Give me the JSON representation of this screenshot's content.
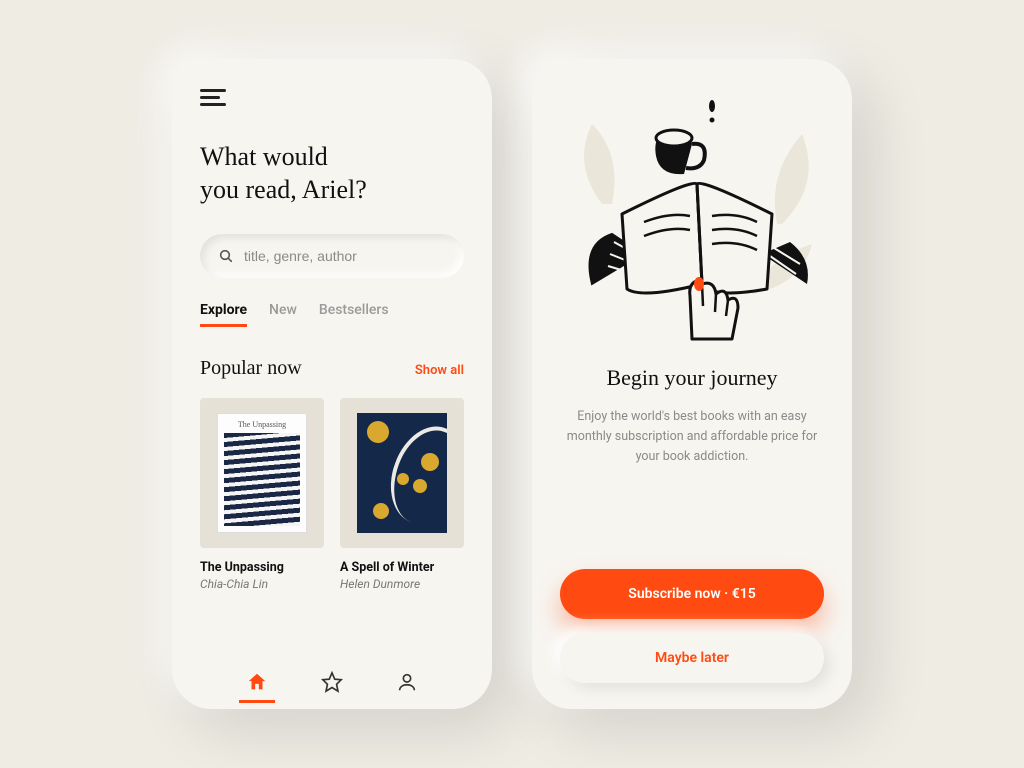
{
  "colors": {
    "accent": "#ff4b12"
  },
  "left": {
    "headline": "What would\nyou read, Ariel?",
    "search_placeholder": "title, genre, author",
    "tabs": [
      "Explore",
      "New",
      "Bestsellers"
    ],
    "active_tab_index": 0,
    "section_title": "Popular now",
    "show_all": "Show all",
    "books": [
      {
        "title": "The Unpassing",
        "author": "Chia-Chia Lin"
      },
      {
        "title": "A Spell of Winter",
        "author": "Helen Dunmore"
      }
    ],
    "nav_icons": [
      "home-icon",
      "star-icon",
      "user-icon"
    ],
    "active_nav_index": 0
  },
  "right": {
    "title": "Begin your journey",
    "body": "Enjoy the world's best books with an easy monthly subscription and affordable price for your book addiction.",
    "primary_label": "Subscribe now · €15",
    "secondary_label": "Maybe later"
  }
}
